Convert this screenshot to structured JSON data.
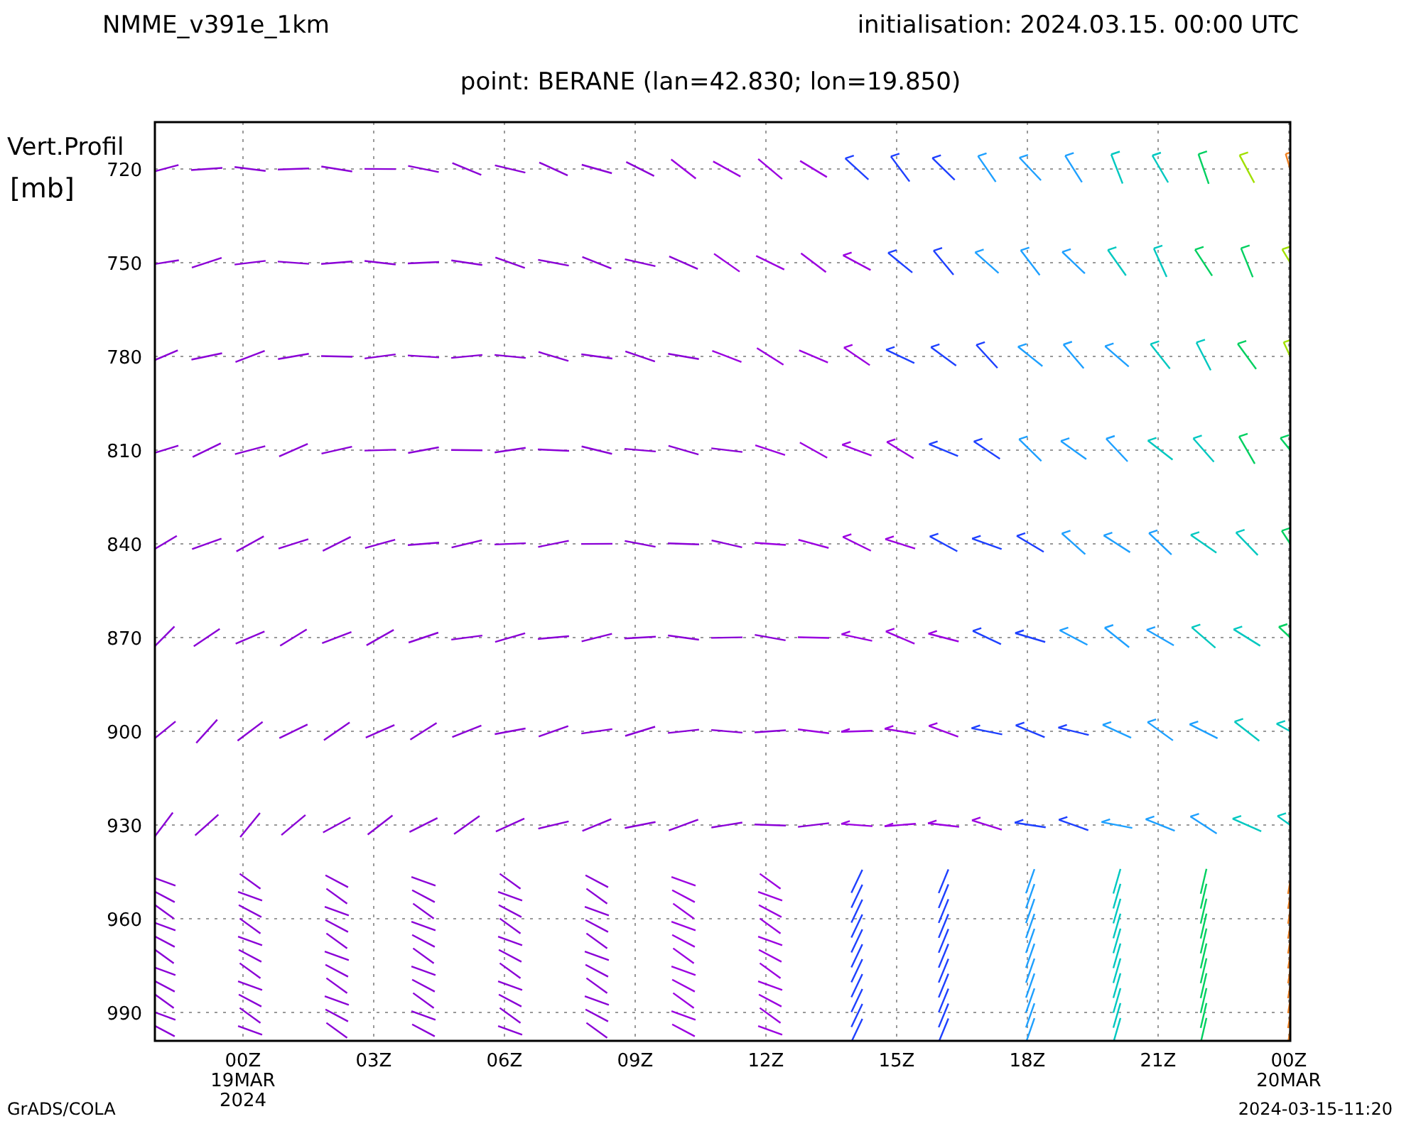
{
  "header": {
    "model": "NMME_v391e_1km",
    "initialisation": "initialisation: 2024.03.15. 00:00 UTC",
    "point": "point: BERANE (lan=42.830; lon=19.850)"
  },
  "y_axis": {
    "title": "Vert.Profil",
    "unit": "[mb]",
    "ticks": [
      "720",
      "750",
      "780",
      "810",
      "840",
      "870",
      "900",
      "930",
      "960",
      "990"
    ]
  },
  "x_axis": {
    "ticks": [
      {
        "label": "00Z",
        "date": "19MAR",
        "year": "2024"
      },
      {
        "label": "03Z"
      },
      {
        "label": "06Z"
      },
      {
        "label": "09Z"
      },
      {
        "label": "12Z"
      },
      {
        "label": "15Z"
      },
      {
        "label": "18Z"
      },
      {
        "label": "21Z"
      },
      {
        "label": "00Z",
        "date": "20MAR"
      }
    ]
  },
  "footer": {
    "source": "GrADS/COLA",
    "timestamp": "2024-03-15-11:20"
  }
}
